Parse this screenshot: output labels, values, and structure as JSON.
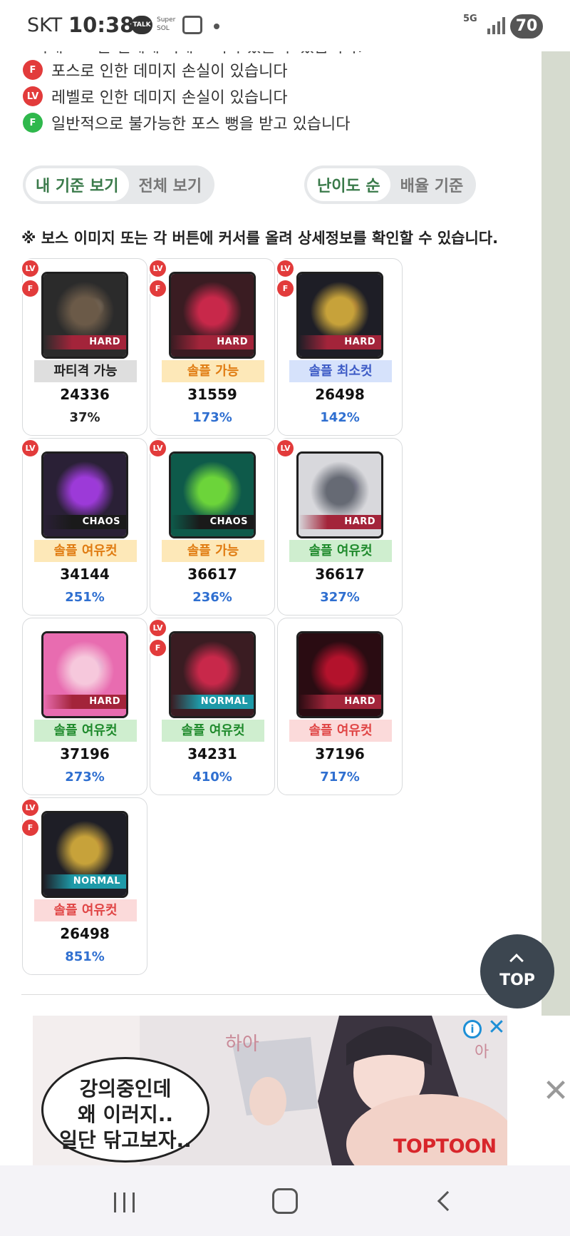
{
  "status_bar": {
    "carrier": "SKT",
    "time": "10:38",
    "talk_icon": "TALK",
    "super_icon": "Super SOL",
    "network": "5G",
    "battery": "70"
  },
  "legend": {
    "cropped_line": "아래 포스는 실제에 비해 크리가 있을 수 있습니다.",
    "items": [
      {
        "badge": "F",
        "color": "#e23b3b",
        "text": "포스로 인한 데미지 손실이 있습니다"
      },
      {
        "badge": "LV",
        "color": "#e23b3b",
        "text": "레벨로 인한 데미지 손실이 있습니다"
      },
      {
        "badge": "F",
        "color": "#2fb84c",
        "text": "일반적으로 불가능한 포스 뻥을 받고 있습니다"
      }
    ]
  },
  "toggles": {
    "view": {
      "active": "내 기준 보기",
      "inactive": "전체 보기"
    },
    "sort": {
      "active": "난이도 순",
      "inactive": "배율 기준"
    }
  },
  "hint": "※ 보스 이미지 또는 각 버튼에 커서를 올려 상세정보를 확인할 수 있습니다.",
  "bosses": [
    {
      "difficulty": "HARD",
      "status": "파티격 가능",
      "status_style": "gray",
      "value": "24336",
      "pct": "37%",
      "pct_color": "#222222",
      "lv": true,
      "f": true
    },
    {
      "difficulty": "HARD",
      "status": "솔플 가능",
      "status_style": "orange",
      "value": "31559",
      "pct": "173%",
      "pct_color": "#2f6fd0",
      "lv": true,
      "f": true
    },
    {
      "difficulty": "HARD",
      "status": "솔플 최소컷",
      "status_style": "blue",
      "value": "26498",
      "pct": "142%",
      "pct_color": "#2f6fd0",
      "lv": true,
      "f": true
    },
    {
      "difficulty": "CHAOS",
      "status": "솔플 여유컷",
      "status_style": "orange",
      "value": "34144",
      "pct": "251%",
      "pct_color": "#2f6fd0",
      "lv": true,
      "f": false
    },
    {
      "difficulty": "CHAOS",
      "status": "솔플 가능",
      "status_style": "orange",
      "value": "36617",
      "pct": "236%",
      "pct_color": "#2f6fd0",
      "lv": true,
      "f": false
    },
    {
      "difficulty": "HARD",
      "status": "솔플 여유컷",
      "status_style": "green",
      "value": "36617",
      "pct": "327%",
      "pct_color": "#2f6fd0",
      "lv": true,
      "f": false
    },
    {
      "difficulty": "HARD",
      "status": "솔플 여유컷",
      "status_style": "green",
      "value": "37196",
      "pct": "273%",
      "pct_color": "#2f6fd0",
      "lv": false,
      "f": false
    },
    {
      "difficulty": "NORMAL",
      "status": "솔플 여유컷",
      "status_style": "green",
      "value": "34231",
      "pct": "410%",
      "pct_color": "#2f6fd0",
      "lv": true,
      "f": true
    },
    {
      "difficulty": "HARD",
      "status": "솔플 여유컷",
      "status_style": "pink",
      "value": "37196",
      "pct": "717%",
      "pct_color": "#2f6fd0",
      "lv": false,
      "f": false
    },
    {
      "difficulty": "NORMAL",
      "status": "솔플 여유컷",
      "status_style": "pink",
      "value": "26498",
      "pct": "851%",
      "pct_color": "#2f6fd0",
      "lv": true,
      "f": true
    }
  ],
  "top_button": {
    "label": "TOP"
  },
  "ad": {
    "bubble_lines": [
      "강의중인데",
      "왜 이러지..",
      "일단 닦고보자.."
    ],
    "brand": "TOPTOON"
  },
  "icons": {
    "talk": "talk-icon",
    "screenshot": "screenshot-icon",
    "signal": "signal-icon",
    "top_arrow": "chevron-up-icon",
    "ad_info": "info-icon",
    "ad_close": "close-icon",
    "nav_recents": "recents-icon",
    "nav_home": "home-icon",
    "nav_back": "back-icon"
  },
  "colors": {
    "accent_green": "#3a7a4a",
    "badge_red": "#e23b3b",
    "badge_green": "#2fb84c",
    "pct_blue": "#2f6fd0"
  }
}
